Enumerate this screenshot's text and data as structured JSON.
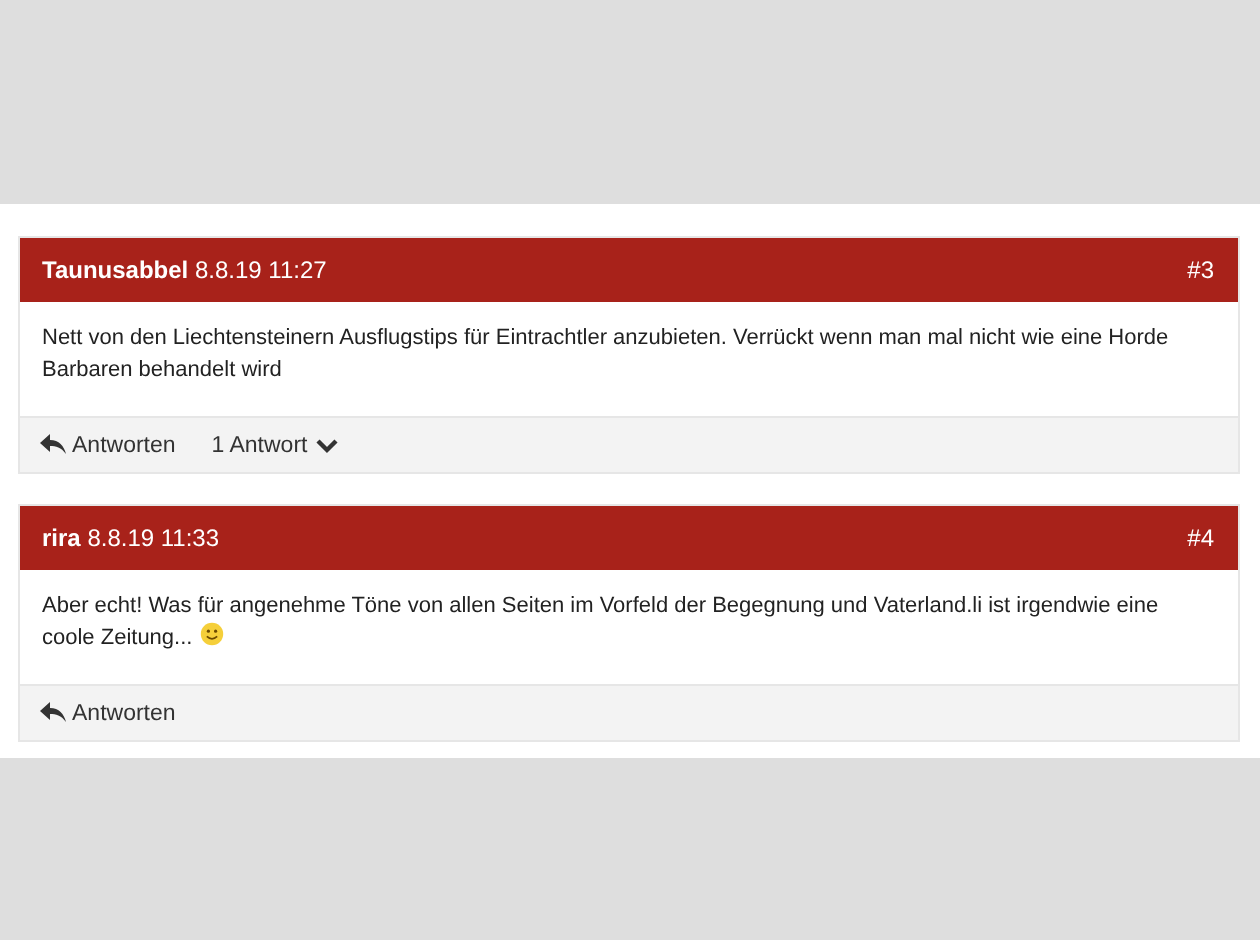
{
  "comments": [
    {
      "author": "Taunusabbel",
      "time": "8.8.19 11:27",
      "number": "#3",
      "text": "Nett von den Liechtensteinern Ausflugstips für Eintrachtler anzubieten. Verrückt wenn man mal nicht wie eine Horde Barbaren behandelt wird",
      "smiley": false,
      "reply_label": "Antworten",
      "replies": "1 Antwort"
    },
    {
      "author": "rira",
      "time": "8.8.19 11:33",
      "number": "#4",
      "text": "Aber echt! Was für angenehme Töne von allen Seiten im Vorfeld der Begegnung und Vaterland.li ist irgendwie eine coole Zeitung...",
      "smiley": true,
      "reply_label": "Antworten"
    }
  ]
}
